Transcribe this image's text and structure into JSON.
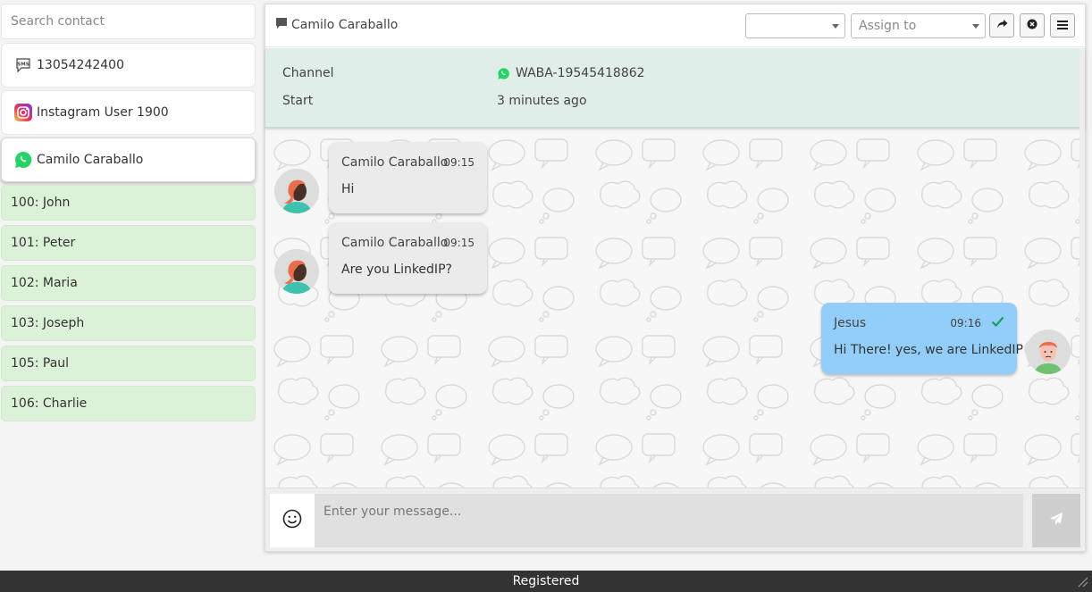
{
  "search": {
    "placeholder": "Search contact"
  },
  "contacts": [
    {
      "label": "13054242400",
      "icon": "sms-icon"
    },
    {
      "label": "Instagram User 1900",
      "icon": "instagram-icon"
    },
    {
      "label": "Camilo Caraballo",
      "icon": "whatsapp-icon",
      "active": true
    }
  ],
  "extensions": [
    {
      "label": "100: John"
    },
    {
      "label": "101: Peter"
    },
    {
      "label": "102: Maria"
    },
    {
      "label": "103: Joseph"
    },
    {
      "label": "105: Paul"
    },
    {
      "label": "106: Charlie"
    }
  ],
  "header": {
    "title": "Camilo Caraballo",
    "first_select_value": "",
    "assign_placeholder": "Assign to",
    "icons": [
      "forward-icon",
      "close-circle-icon",
      "menu-icon"
    ]
  },
  "info": {
    "channel_label": "Channel",
    "channel_value": "WABA-19545418862",
    "start_label": "Start",
    "start_value": "3 minutes ago"
  },
  "messages": [
    {
      "direction": "in",
      "from": "Camilo Caraballo",
      "time": "09:15",
      "text": "Hi"
    },
    {
      "direction": "in",
      "from": "Camilo Caraballo",
      "time": "09:15",
      "text": "Are you LinkedIP?"
    },
    {
      "direction": "out",
      "from": "Jesus",
      "time": "09:16",
      "text": "Hi There! yes, we are LinkedIP",
      "status": "check-icon"
    }
  ],
  "composer": {
    "placeholder": "Enter your message..."
  },
  "status": {
    "text": "Registered"
  },
  "colors": {
    "extension_bg": "#dcf2d8",
    "info_bg": "#dfeee9",
    "incoming_bubble": "#ebebeb",
    "outgoing_bubble": "#93cdfa",
    "status_bar": "#333333",
    "whatsapp_green": "#25d366"
  }
}
